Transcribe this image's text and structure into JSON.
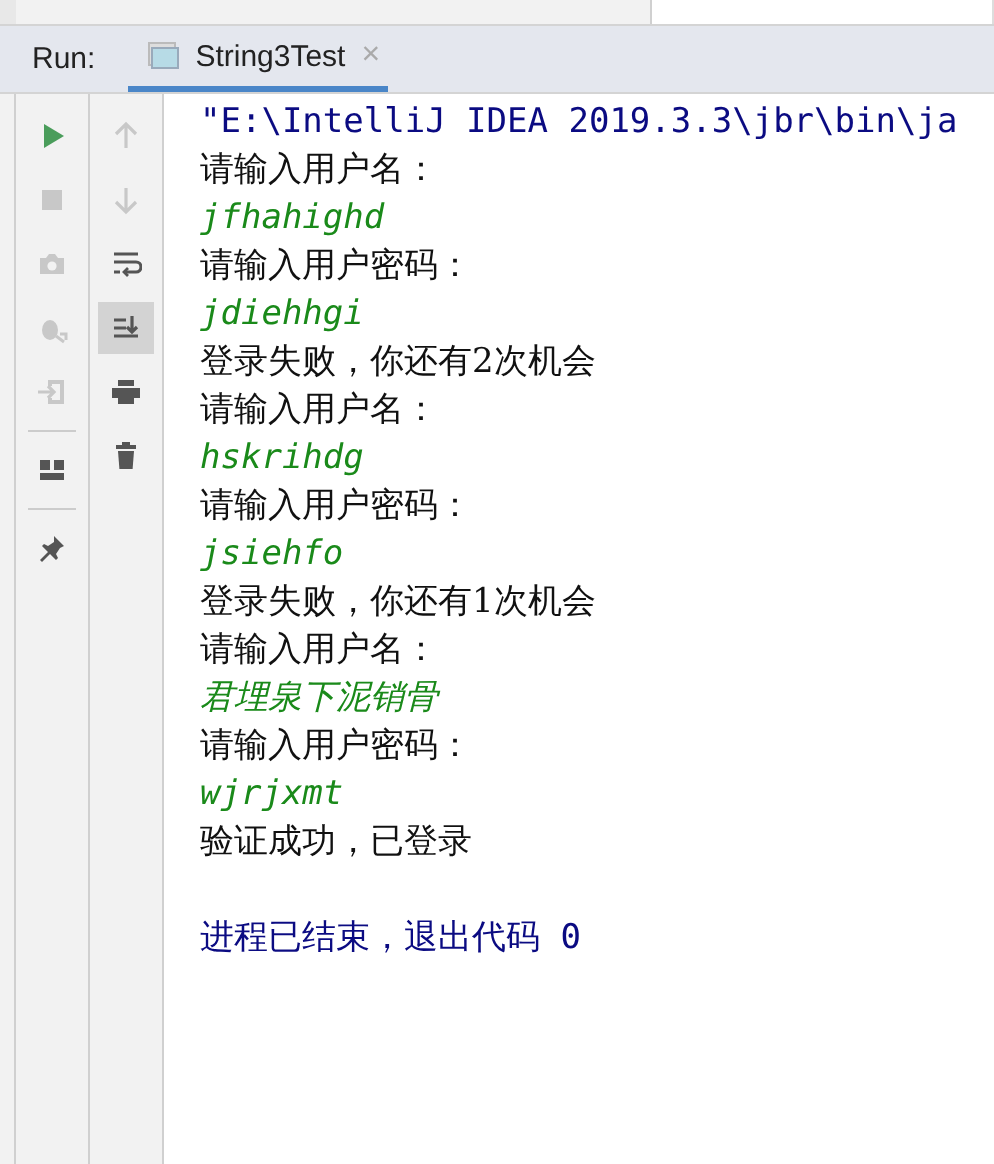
{
  "run_bar": {
    "label": "Run:",
    "tabs": [
      {
        "label": "String3Test",
        "selected": true,
        "close": "×"
      }
    ]
  },
  "toolbar_left": [
    {
      "kind": "run",
      "disabled": false
    },
    {
      "kind": "stop",
      "disabled": true
    },
    {
      "kind": "camera",
      "disabled": true
    },
    {
      "kind": "debug",
      "disabled": true
    },
    {
      "kind": "login",
      "disabled": true
    },
    {
      "kind": "separator"
    },
    {
      "kind": "layout",
      "disabled": false
    },
    {
      "kind": "separator"
    },
    {
      "kind": "pin",
      "disabled": false
    }
  ],
  "toolbar_right": [
    {
      "kind": "up",
      "disabled": true,
      "selected": false
    },
    {
      "kind": "down",
      "disabled": true,
      "selected": false
    },
    {
      "kind": "wrap",
      "disabled": false,
      "selected": false
    },
    {
      "kind": "scroll-end",
      "disabled": false,
      "selected": true
    },
    {
      "kind": "print",
      "disabled": false,
      "selected": false
    },
    {
      "kind": "trash",
      "disabled": false,
      "selected": false
    }
  ],
  "console": [
    {
      "kind": "system",
      "text": "\"E:\\IntelliJ IDEA 2019.3.3\\jbr\\bin\\ja"
    },
    {
      "kind": "output",
      "text": "请输入用户名："
    },
    {
      "kind": "input",
      "text": "jfhahighd"
    },
    {
      "kind": "output",
      "text": "请输入用户密码："
    },
    {
      "kind": "input",
      "text": "jdiehhgi"
    },
    {
      "kind": "output",
      "text": "登录失败，你还有2次机会"
    },
    {
      "kind": "output",
      "text": "请输入用户名："
    },
    {
      "kind": "input",
      "text": "hskrihdg"
    },
    {
      "kind": "output",
      "text": "请输入用户密码："
    },
    {
      "kind": "input",
      "text": "jsiehfo"
    },
    {
      "kind": "output",
      "text": "登录失败，你还有1次机会"
    },
    {
      "kind": "output",
      "text": "请输入用户名："
    },
    {
      "kind": "input",
      "text": "君埋泉下泥销骨"
    },
    {
      "kind": "output",
      "text": "请输入用户密码："
    },
    {
      "kind": "input",
      "text": "wjrjxmt"
    },
    {
      "kind": "output",
      "text": "验证成功，已登录"
    },
    {
      "kind": "blank"
    },
    {
      "kind": "system",
      "text": "进程已结束，退出代码 0"
    }
  ]
}
